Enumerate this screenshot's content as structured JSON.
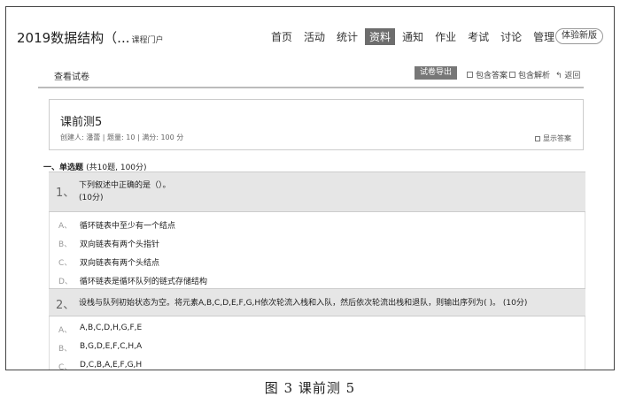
{
  "header": {
    "course_title": "2019数据结构（...",
    "portal_link": "课程门户",
    "nav": [
      "首页",
      "活动",
      "统计",
      "资料",
      "通知",
      "作业",
      "考试",
      "讨论",
      "管理"
    ],
    "active_nav": "资料",
    "trial_button": "体验新版"
  },
  "toolbar": {
    "title": "查看试卷",
    "export_button": "试卷导出",
    "include_answer": "包含答案",
    "include_analysis": "包含解析",
    "back": "返回"
  },
  "exam": {
    "name": "课前测5",
    "meta": "创建人: 潘蕾 | 题量: 10 | 满分: 100 分",
    "show_answer": "显示答案"
  },
  "section": {
    "title": "一、单选题",
    "count": "(共10题, 100分)"
  },
  "questions": [
    {
      "number": "1、",
      "text": "下列叙述中正确的是（）。",
      "score": "(10分)",
      "options": [
        {
          "label": "A、",
          "text": "循环链表中至少有一个结点"
        },
        {
          "label": "B、",
          "text": "双向链表有两个头指针"
        },
        {
          "label": "C、",
          "text": "双向链表有两个头结点"
        },
        {
          "label": "D、",
          "text": "循环链表是循环队列的链式存储结构"
        }
      ]
    },
    {
      "number": "2、",
      "text": "设栈与队列初始状态为空。将元素A,B,C,D,E,F,G,H依次轮流入栈和入队，然后依次轮流出栈和退队，则输出序列为( )。 (10分)",
      "options": [
        {
          "label": "A、",
          "text": "A,B,C,D,H,G,F,E"
        },
        {
          "label": "B、",
          "text": "B,G,D,E,F,C,H,A"
        },
        {
          "label": "C、",
          "text": "D,C,B,A,E,F,G,H"
        }
      ]
    }
  ],
  "caption": "图 3   课前测 5"
}
